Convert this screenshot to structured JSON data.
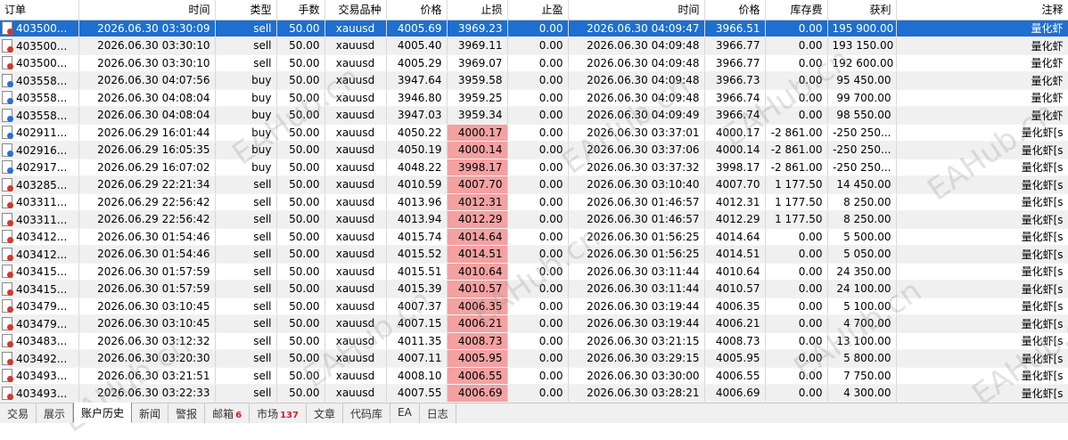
{
  "columns": [
    "订单",
    "时间",
    "类型",
    "手数",
    "交易品种",
    "价格",
    "止损",
    "止盈",
    "时间",
    "价格",
    "库存费",
    "获利",
    "注释"
  ],
  "rows": [
    {
      "order": "403500...",
      "open_time": "2026.06.30 03:30:09",
      "type": "sell",
      "lots": "50.00",
      "symbol": "xauusd",
      "price": "4005.69",
      "sl": "3969.23",
      "tp": "0.00",
      "close_time": "2026.06.30 04:09:47",
      "close_price": "3966.51",
      "swap": "0.00",
      "profit": "195 900.00",
      "comment": "量化虾",
      "selected": true,
      "sl_hit": false
    },
    {
      "order": "403500...",
      "open_time": "2026.06.30 03:30:10",
      "type": "sell",
      "lots": "50.00",
      "symbol": "xauusd",
      "price": "4005.40",
      "sl": "3969.11",
      "tp": "0.00",
      "close_time": "2026.06.30 04:09:48",
      "close_price": "3966.77",
      "swap": "0.00",
      "profit": "193 150.00",
      "comment": "量化虾",
      "selected": false,
      "sl_hit": false
    },
    {
      "order": "403500...",
      "open_time": "2026.06.30 03:30:10",
      "type": "sell",
      "lots": "50.00",
      "symbol": "xauusd",
      "price": "4005.29",
      "sl": "3969.07",
      "tp": "0.00",
      "close_time": "2026.06.30 04:09:48",
      "close_price": "3966.77",
      "swap": "0.00",
      "profit": "192 600.00",
      "comment": "量化虾",
      "selected": false,
      "sl_hit": false
    },
    {
      "order": "403558...",
      "open_time": "2026.06.30 04:07:56",
      "type": "buy",
      "lots": "50.00",
      "symbol": "xauusd",
      "price": "3947.64",
      "sl": "3959.58",
      "tp": "0.00",
      "close_time": "2026.06.30 04:09:48",
      "close_price": "3966.73",
      "swap": "0.00",
      "profit": "95 450.00",
      "comment": "量化虾",
      "selected": false,
      "sl_hit": false
    },
    {
      "order": "403558...",
      "open_time": "2026.06.30 04:08:04",
      "type": "buy",
      "lots": "50.00",
      "symbol": "xauusd",
      "price": "3946.80",
      "sl": "3959.25",
      "tp": "0.00",
      "close_time": "2026.06.30 04:09:48",
      "close_price": "3966.74",
      "swap": "0.00",
      "profit": "99 700.00",
      "comment": "量化虾",
      "selected": false,
      "sl_hit": false
    },
    {
      "order": "403558...",
      "open_time": "2026.06.30 04:08:04",
      "type": "buy",
      "lots": "50.00",
      "symbol": "xauusd",
      "price": "3947.03",
      "sl": "3959.34",
      "tp": "0.00",
      "close_time": "2026.06.30 04:09:49",
      "close_price": "3966.74",
      "swap": "0.00",
      "profit": "98 550.00",
      "comment": "量化虾",
      "selected": false,
      "sl_hit": false
    },
    {
      "order": "402911...",
      "open_time": "2026.06.29 16:01:44",
      "type": "buy",
      "lots": "50.00",
      "symbol": "xauusd",
      "price": "4050.22",
      "sl": "4000.17",
      "tp": "0.00",
      "close_time": "2026.06.30 03:37:01",
      "close_price": "4000.17",
      "swap": "-2 861.00",
      "profit": "-250 250...",
      "comment": "量化虾[s",
      "selected": false,
      "sl_hit": true
    },
    {
      "order": "402916...",
      "open_time": "2026.06.29 16:05:35",
      "type": "buy",
      "lots": "50.00",
      "symbol": "xauusd",
      "price": "4050.19",
      "sl": "4000.14",
      "tp": "0.00",
      "close_time": "2026.06.30 03:37:06",
      "close_price": "4000.14",
      "swap": "-2 861.00",
      "profit": "-250 250...",
      "comment": "量化虾[s",
      "selected": false,
      "sl_hit": true
    },
    {
      "order": "402917...",
      "open_time": "2026.06.29 16:07:02",
      "type": "buy",
      "lots": "50.00",
      "symbol": "xauusd",
      "price": "4048.22",
      "sl": "3998.17",
      "tp": "0.00",
      "close_time": "2026.06.30 03:37:32",
      "close_price": "3998.17",
      "swap": "-2 861.00",
      "profit": "-250 250...",
      "comment": "量化虾[s",
      "selected": false,
      "sl_hit": true
    },
    {
      "order": "403285...",
      "open_time": "2026.06.29 22:21:34",
      "type": "sell",
      "lots": "50.00",
      "symbol": "xauusd",
      "price": "4010.59",
      "sl": "4007.70",
      "tp": "0.00",
      "close_time": "2026.06.30 03:10:40",
      "close_price": "4007.70",
      "swap": "1 177.50",
      "profit": "14 450.00",
      "comment": "量化虾[s",
      "selected": false,
      "sl_hit": true
    },
    {
      "order": "403311...",
      "open_time": "2026.06.29 22:56:42",
      "type": "sell",
      "lots": "50.00",
      "symbol": "xauusd",
      "price": "4013.96",
      "sl": "4012.31",
      "tp": "0.00",
      "close_time": "2026.06.30 01:46:57",
      "close_price": "4012.31",
      "swap": "1 177.50",
      "profit": "8 250.00",
      "comment": "量化虾[s",
      "selected": false,
      "sl_hit": true
    },
    {
      "order": "403311...",
      "open_time": "2026.06.29 22:56:42",
      "type": "sell",
      "lots": "50.00",
      "symbol": "xauusd",
      "price": "4013.94",
      "sl": "4012.29",
      "tp": "0.00",
      "close_time": "2026.06.30 01:46:57",
      "close_price": "4012.29",
      "swap": "1 177.50",
      "profit": "8 250.00",
      "comment": "量化虾[s",
      "selected": false,
      "sl_hit": true
    },
    {
      "order": "403412...",
      "open_time": "2026.06.30 01:54:46",
      "type": "sell",
      "lots": "50.00",
      "symbol": "xauusd",
      "price": "4015.74",
      "sl": "4014.64",
      "tp": "0.00",
      "close_time": "2026.06.30 01:56:25",
      "close_price": "4014.64",
      "swap": "0.00",
      "profit": "5 500.00",
      "comment": "量化虾[s",
      "selected": false,
      "sl_hit": true
    },
    {
      "order": "403412...",
      "open_time": "2026.06.30 01:54:46",
      "type": "sell",
      "lots": "50.00",
      "symbol": "xauusd",
      "price": "4015.52",
      "sl": "4014.51",
      "tp": "0.00",
      "close_time": "2026.06.30 01:56:25",
      "close_price": "4014.51",
      "swap": "0.00",
      "profit": "5 050.00",
      "comment": "量化虾[s",
      "selected": false,
      "sl_hit": true
    },
    {
      "order": "403415...",
      "open_time": "2026.06.30 01:57:59",
      "type": "sell",
      "lots": "50.00",
      "symbol": "xauusd",
      "price": "4015.51",
      "sl": "4010.64",
      "tp": "0.00",
      "close_time": "2026.06.30 03:11:44",
      "close_price": "4010.64",
      "swap": "0.00",
      "profit": "24 350.00",
      "comment": "量化虾[s",
      "selected": false,
      "sl_hit": true
    },
    {
      "order": "403415...",
      "open_time": "2026.06.30 01:57:59",
      "type": "sell",
      "lots": "50.00",
      "symbol": "xauusd",
      "price": "4015.39",
      "sl": "4010.57",
      "tp": "0.00",
      "close_time": "2026.06.30 03:11:44",
      "close_price": "4010.57",
      "swap": "0.00",
      "profit": "24 100.00",
      "comment": "量化虾[s",
      "selected": false,
      "sl_hit": true
    },
    {
      "order": "403479...",
      "open_time": "2026.06.30 03:10:45",
      "type": "sell",
      "lots": "50.00",
      "symbol": "xauusd",
      "price": "4007.37",
      "sl": "4006.35",
      "tp": "0.00",
      "close_time": "2026.06.30 03:19:44",
      "close_price": "4006.35",
      "swap": "0.00",
      "profit": "5 100.00",
      "comment": "量化虾[s",
      "selected": false,
      "sl_hit": true
    },
    {
      "order": "403479...",
      "open_time": "2026.06.30 03:10:45",
      "type": "sell",
      "lots": "50.00",
      "symbol": "xauusd",
      "price": "4007.15",
      "sl": "4006.21",
      "tp": "0.00",
      "close_time": "2026.06.30 03:19:44",
      "close_price": "4006.21",
      "swap": "0.00",
      "profit": "4 700.00",
      "comment": "量化虾[s",
      "selected": false,
      "sl_hit": true
    },
    {
      "order": "403483...",
      "open_time": "2026.06.30 03:12:32",
      "type": "sell",
      "lots": "50.00",
      "symbol": "xauusd",
      "price": "4011.35",
      "sl": "4008.73",
      "tp": "0.00",
      "close_time": "2026.06.30 03:21:15",
      "close_price": "4008.73",
      "swap": "0.00",
      "profit": "13 100.00",
      "comment": "量化虾[s",
      "selected": false,
      "sl_hit": true
    },
    {
      "order": "403492...",
      "open_time": "2026.06.30 03:20:30",
      "type": "sell",
      "lots": "50.00",
      "symbol": "xauusd",
      "price": "4007.11",
      "sl": "4005.95",
      "tp": "0.00",
      "close_time": "2026.06.30 03:29:15",
      "close_price": "4005.95",
      "swap": "0.00",
      "profit": "5 800.00",
      "comment": "量化虾[s",
      "selected": false,
      "sl_hit": true
    },
    {
      "order": "403493...",
      "open_time": "2026.06.30 03:21:51",
      "type": "sell",
      "lots": "50.00",
      "symbol": "xauusd",
      "price": "4008.10",
      "sl": "4006.55",
      "tp": "0.00",
      "close_time": "2026.06.30 03:30:00",
      "close_price": "4006.55",
      "swap": "0.00",
      "profit": "7 750.00",
      "comment": "量化虾[s",
      "selected": false,
      "sl_hit": true
    },
    {
      "order": "403493...",
      "open_time": "2026.06.30 03:22:33",
      "type": "sell",
      "lots": "50.00",
      "symbol": "xauusd",
      "price": "4007.55",
      "sl": "4006.69",
      "tp": "0.00",
      "close_time": "2026.06.30 03:28:21",
      "close_price": "4006.69",
      "swap": "0.00",
      "profit": "4 300.00",
      "comment": "量化虾[s",
      "selected": false,
      "sl_hit": true
    }
  ],
  "tabs": [
    {
      "label": "交易",
      "badge": "",
      "active": false
    },
    {
      "label": "展示",
      "badge": "",
      "active": false
    },
    {
      "label": "账户历史",
      "badge": "",
      "active": true
    },
    {
      "label": "新闻",
      "badge": "",
      "active": false
    },
    {
      "label": "警报",
      "badge": "",
      "active": false
    },
    {
      "label": "邮箱",
      "badge": "6",
      "active": false
    },
    {
      "label": "市场",
      "badge": "137",
      "active": false
    },
    {
      "label": "文章",
      "badge": "",
      "active": false
    },
    {
      "label": "代码库",
      "badge": "",
      "active": false
    },
    {
      "label": "EA",
      "badge": "",
      "active": false
    },
    {
      "label": "日志",
      "badge": "",
      "active": false
    }
  ],
  "watermark": "EAHub.cn",
  "colors": {
    "selected_row": "#1e6fd0",
    "sl_hit": "#f3a1a1",
    "sell_icon": "#d8362a",
    "buy_icon": "#2b6fd6",
    "alt_row": "#f0f0f0"
  }
}
